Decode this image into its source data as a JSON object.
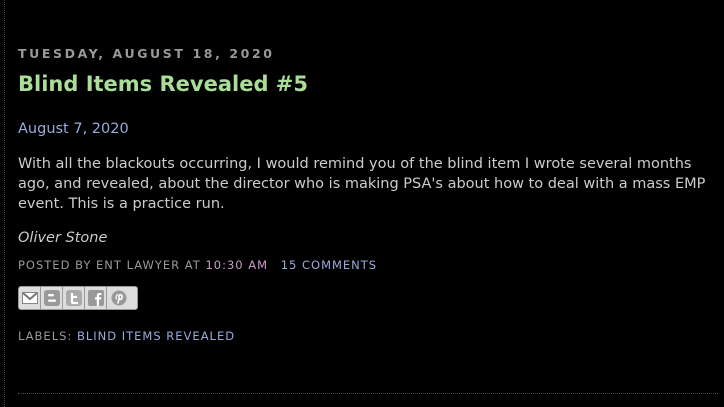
{
  "post": {
    "date_header": "TUESDAY, AUGUST 18, 2020",
    "title": "Blind Items Revealed #5",
    "date_line": "August 7, 2020",
    "body": "With all the blackouts occurring, I would remind you of the blind item I wrote several months ago, and revealed, about the director who is making PSA's about how to deal with a mass EMP event. This is a practice run.",
    "answer": "Oliver Stone",
    "footer": {
      "posted_by_prefix": "POSTED BY ENT LAWYER AT",
      "time": "10:30 AM",
      "comments": "15 COMMENTS"
    },
    "share_buttons": [
      {
        "name": "email-icon"
      },
      {
        "name": "blogger-icon"
      },
      {
        "name": "twitter-icon"
      },
      {
        "name": "facebook-icon"
      },
      {
        "name": "pinterest-icon"
      }
    ],
    "labels": {
      "prefix": "LABELS:",
      "items": [
        "BLIND ITEMS REVEALED"
      ]
    }
  },
  "colors": {
    "background": "#000000",
    "title": "#aadd99",
    "link": "#99aadd",
    "time": "#cc99cc",
    "body_text": "#cccccc",
    "meta_text": "#999999"
  }
}
